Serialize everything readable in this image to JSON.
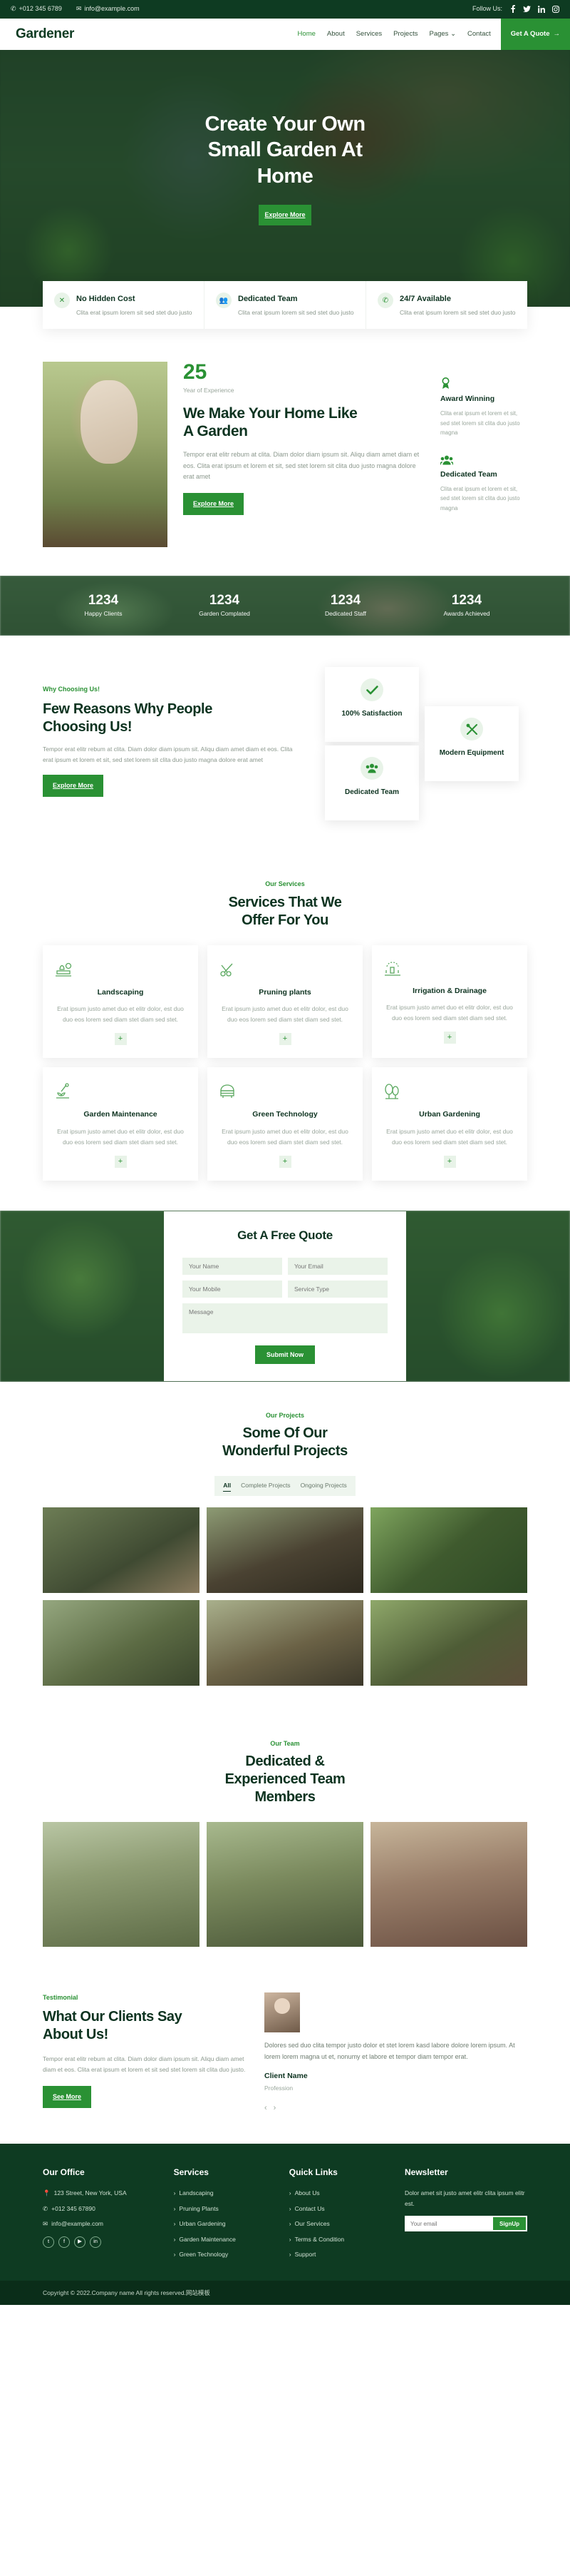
{
  "topbar": {
    "phone": "+012 345 6789",
    "email": "info@example.com",
    "follow_label": "Follow Us:",
    "socials": [
      {
        "name": "facebook-icon",
        "glyph": "f"
      },
      {
        "name": "twitter-icon",
        "glyph": "🐦"
      },
      {
        "name": "linkedin-icon",
        "glyph": "in"
      },
      {
        "name": "instagram-icon",
        "glyph": "◎"
      }
    ]
  },
  "nav": {
    "brand": "Gardener",
    "items": [
      {
        "label": "Home",
        "active": true
      },
      {
        "label": "About",
        "active": false
      },
      {
        "label": "Services",
        "active": false
      },
      {
        "label": "Projects",
        "active": false
      },
      {
        "label": "Pages",
        "active": false,
        "caret": "⌄"
      },
      {
        "label": "Contact",
        "active": false
      }
    ],
    "cta": "Get A Quote",
    "cta_arrow": "→"
  },
  "hero": {
    "title_line1": "Create Your Own",
    "title_line2": "Small Garden At",
    "title_line3": "Home",
    "button": "Explore More"
  },
  "features": [
    {
      "icon": "leaf-icon",
      "glyph": "✕",
      "title": "No Hidden Cost",
      "text": "Clita erat ipsum lorem sit sed stet duo justo"
    },
    {
      "icon": "team-icon",
      "glyph": "👥",
      "title": "Dedicated Team",
      "text": "Clita erat ipsum lorem sit sed stet duo justo"
    },
    {
      "icon": "phone-icon",
      "glyph": "✆",
      "title": "24/7 Available",
      "text": "Clita erat ipsum lorem sit sed stet duo justo"
    }
  ],
  "about": {
    "years": "25",
    "years_label": "Year of Experience",
    "heading_l1": "We Make Your Home Like",
    "heading_l2": "A Garden",
    "text": "Tempor erat elitr rebum at clita. Diam dolor diam ipsum sit. Aliqu diam amet diam et eos. Clita erat ipsum et lorem et sit, sed stet lorem sit clita duo justo magna dolore erat amet",
    "button": "Explore More",
    "side": [
      {
        "icon": "award-icon",
        "glyph": "🏅",
        "title": "Award Winning",
        "text": "Clita erat ipsum et lorem et sit, sed stet lorem sit clita duo justo magna"
      },
      {
        "icon": "team-icon",
        "glyph": "👥",
        "title": "Dedicated Team",
        "text": "Clita erat ipsum et lorem et sit, sed stet lorem sit clita duo justo magna"
      }
    ]
  },
  "facts": [
    {
      "number": "1234",
      "label": "Happy Clients"
    },
    {
      "number": "1234",
      "label": "Garden Complated"
    },
    {
      "number": "1234",
      "label": "Dedicated Staff"
    },
    {
      "number": "1234",
      "label": "Awards Achieved"
    }
  ],
  "why": {
    "eyebrow": "Why Choosing Us!",
    "heading_l1": "Few Reasons Why People",
    "heading_l2": "Choosing Us!",
    "text": "Tempor erat elitr rebum at clita. Diam dolor diam ipsum sit. Aliqu diam amet diam et eos. Clita erat ipsum et lorem et sit, sed stet lorem sit clita duo justo magna dolore erat amet",
    "button": "Explore More",
    "cards": [
      {
        "icon": "check-icon",
        "glyph": "✔",
        "title": "100% Satisfaction"
      },
      {
        "icon": "team-icon",
        "glyph": "👥",
        "title": "Dedicated Team"
      },
      {
        "icon": "tools-icon",
        "glyph": "✂",
        "title": "Modern Equipment"
      }
    ]
  },
  "services": {
    "eyebrow": "Our Services",
    "heading_l1": "Services That We",
    "heading_l2": "Offer For You",
    "plus": "+",
    "items": [
      {
        "icon": "landscaping-icon",
        "glyph": "🌳",
        "title": "Landscaping",
        "text": "Erat ipsum justo amet duo et elitr dolor, est duo duo eos lorem sed diam stet diam sed stet."
      },
      {
        "icon": "pruning-icon",
        "glyph": "✂",
        "title": "Pruning plants",
        "text": "Erat ipsum justo amet duo et elitr dolor, est duo duo eos lorem sed diam stet diam sed stet."
      },
      {
        "icon": "irrigation-icon",
        "glyph": "💧",
        "title": "Irrigation & Drainage",
        "text": "Erat ipsum justo amet duo et elitr dolor, est duo duo eos lorem sed diam stet diam sed stet."
      },
      {
        "icon": "maintenance-icon",
        "glyph": "🌱",
        "title": "Garden Maintenance",
        "text": "Erat ipsum justo amet duo et elitr dolor, est duo duo eos lorem sed diam stet diam sed stet."
      },
      {
        "icon": "greenhouse-icon",
        "glyph": "🏡",
        "title": "Green Technology",
        "text": "Erat ipsum justo amet duo et elitr dolor, est duo duo eos lorem sed diam stet diam sed stet."
      },
      {
        "icon": "urban-icon",
        "glyph": "🌲",
        "title": "Urban Gardening",
        "text": "Erat ipsum justo amet duo et elitr dolor, est duo duo eos lorem sed diam stet diam sed stet."
      }
    ]
  },
  "quote": {
    "title": "Get A Free Quote",
    "name_ph": "Your Name",
    "email_ph": "Your Email",
    "mobile_ph": "Your Mobile",
    "service_ph": "Service Type",
    "message_ph": "Message",
    "submit": "Submit Now"
  },
  "projects": {
    "eyebrow": "Our Projects",
    "heading_l1": "Some Of Our",
    "heading_l2": "Wonderful Projects",
    "filters": [
      {
        "label": "All",
        "active": true
      },
      {
        "label": "Complete Projects",
        "active": false
      },
      {
        "label": "Ongoing Projects",
        "active": false
      }
    ],
    "count": 6
  },
  "team": {
    "eyebrow": "Our Team",
    "heading_l1": "Dedicated &",
    "heading_l2": "Experienced Team",
    "heading_l3": "Members",
    "count": 3
  },
  "testimonial": {
    "eyebrow": "Testimonial",
    "heading_l1": "What Our Clients Say",
    "heading_l2": "About Us!",
    "text": "Tempor erat elitr rebum at clita. Diam dolor diam ipsum sit. Aliqu diam amet diam et eos. Clita erat ipsum et lorem et sit sed stet lorem sit clita duo justo.",
    "button": "See More",
    "quote": "Dolores sed duo clita tempor justo dolor et stet lorem kasd labore dolore lorem ipsum. At lorem lorem magna ut et, nonumy et labore et tempor diam tempor erat.",
    "client_name": "Client Name",
    "client_profession": "Profession",
    "prev": "‹",
    "next": "›"
  },
  "footer": {
    "office": {
      "title": "Our Office",
      "address": "123 Street, New York, USA",
      "phone": "+012 345 67890",
      "email": "info@example.com",
      "socials": [
        {
          "name": "twitter-icon",
          "glyph": "t"
        },
        {
          "name": "facebook-icon",
          "glyph": "f"
        },
        {
          "name": "youtube-icon",
          "glyph": "▶"
        },
        {
          "name": "linkedin-icon",
          "glyph": "in"
        }
      ]
    },
    "services": {
      "title": "Services",
      "items": [
        "Landscaping",
        "Pruning Plants",
        "Urban Gardening",
        "Garden Maintenance",
        "Green Technology"
      ]
    },
    "quick": {
      "title": "Quick Links",
      "items": [
        "About Us",
        "Contact Us",
        "Our Services",
        "Terms & Condition",
        "Support"
      ]
    },
    "newsletter": {
      "title": "Newsletter",
      "text": "Dolor amet sit justo amet elitr clita ipsum elitr est.",
      "placeholder": "Your email",
      "button": "SignUp"
    },
    "copyright": "Copyright © 2022.Company name All rights reserved.网站模板"
  }
}
